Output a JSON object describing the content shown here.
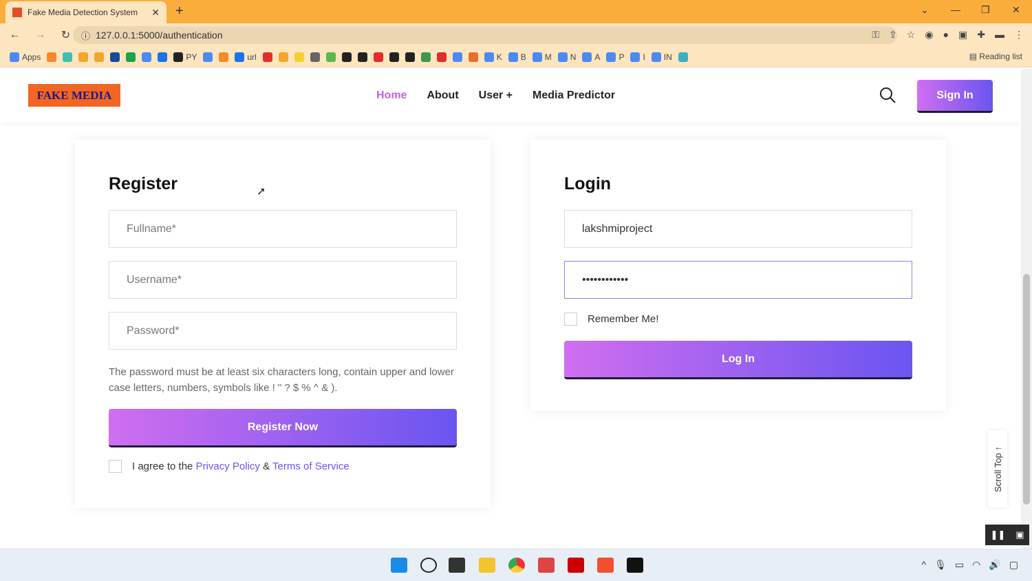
{
  "browser": {
    "tab_title": "Fake Media Detection System",
    "url": "127.0.0.1:5000/authentication",
    "reading_list": "Reading list",
    "bookmarks": [
      {
        "label": "Apps",
        "color": "#4a8af4"
      },
      {
        "label": "",
        "color": "#f48a2a"
      },
      {
        "label": "",
        "color": "#3cbfae"
      },
      {
        "label": "",
        "color": "#f4a52a"
      },
      {
        "label": "",
        "color": "#f4a52a"
      },
      {
        "label": "",
        "color": "#1a4a9a"
      },
      {
        "label": "",
        "color": "#1aa34a"
      },
      {
        "label": "",
        "color": "#4a8af4"
      },
      {
        "label": "",
        "color": "#1a73e8"
      },
      {
        "label": "PY",
        "color": "#222"
      },
      {
        "label": "",
        "color": "#4a8af4"
      },
      {
        "label": "",
        "color": "#f48a2a"
      },
      {
        "label": "url",
        "color": "#1a73e8"
      },
      {
        "label": "",
        "color": "#e52d27"
      },
      {
        "label": "",
        "color": "#f4a52a"
      },
      {
        "label": "",
        "color": "#f4d02a"
      },
      {
        "label": "",
        "color": "#666"
      },
      {
        "label": "",
        "color": "#5ab84a"
      },
      {
        "label": "",
        "color": "#222"
      },
      {
        "label": "",
        "color": "#222"
      },
      {
        "label": "",
        "color": "#e52d27"
      },
      {
        "label": "",
        "color": "#222"
      },
      {
        "label": "",
        "color": "#222"
      },
      {
        "label": "",
        "color": "#3a9a4a"
      },
      {
        "label": "",
        "color": "#e52d27"
      },
      {
        "label": "",
        "color": "#4a8af4"
      },
      {
        "label": "",
        "color": "#e8702a"
      },
      {
        "label": "K",
        "color": "#4a8af4"
      },
      {
        "label": "B",
        "color": "#4a8af4"
      },
      {
        "label": "M",
        "color": "#4a8af4"
      },
      {
        "label": "N",
        "color": "#4a8af4"
      },
      {
        "label": "A",
        "color": "#4a8af4"
      },
      {
        "label": "P",
        "color": "#4a8af4"
      },
      {
        "label": "I",
        "color": "#4a8af4"
      },
      {
        "label": "IN",
        "color": "#4a8af4"
      },
      {
        "label": "",
        "color": "#3ab0c0"
      }
    ]
  },
  "header": {
    "logo": "FAKE MEDIA",
    "menu": [
      "Home",
      "About",
      "User +",
      "Media Predictor"
    ],
    "sign_in": "Sign In"
  },
  "register": {
    "title": "Register",
    "fullname_placeholder": "Fullname*",
    "username_placeholder": "Username*",
    "password_placeholder": "Password*",
    "hint": "The password must be at least six characters long, contain upper and lower case letters, numbers, symbols like ! \" ? $ % ^ & ).",
    "button": "Register Now",
    "agree_prefix": "I agree to the ",
    "privacy": "Privacy Policy",
    "amp": " & ",
    "terms": "Terms of Service"
  },
  "login": {
    "title": "Login",
    "username_value": "lakshmiproject",
    "password_value": "••••••••••••",
    "remember": "Remember Me!",
    "button": "Log In"
  },
  "scroll_top": "Scroll Top ↑"
}
